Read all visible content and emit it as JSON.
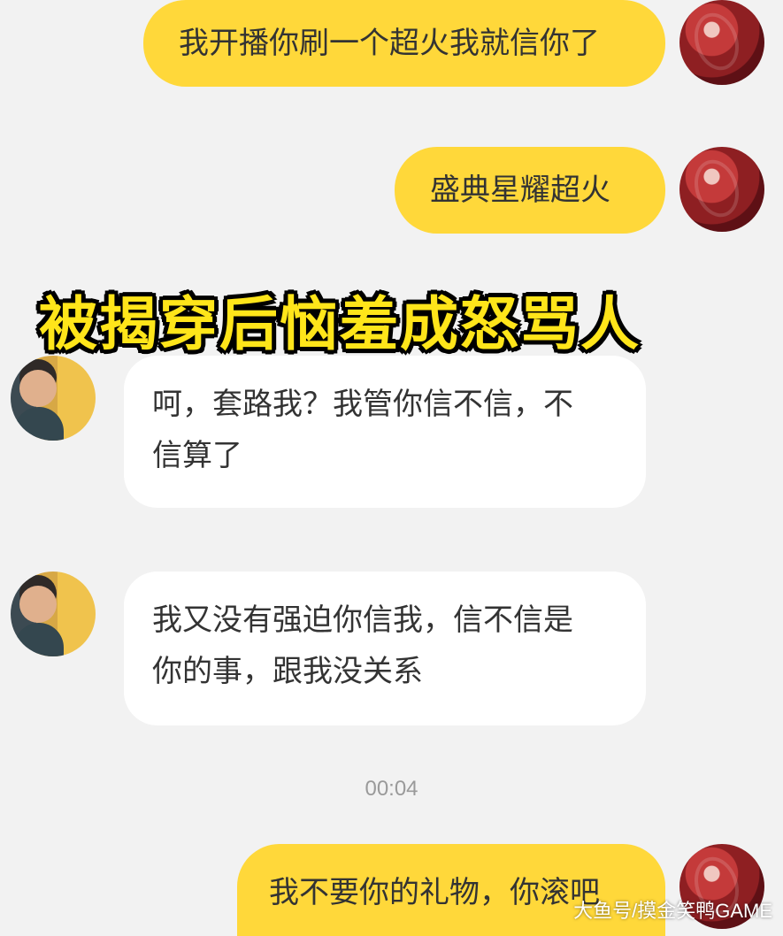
{
  "messages": [
    {
      "sender": "me",
      "text": "我开播你刷一个超火我就信你了"
    },
    {
      "sender": "me",
      "text": "盛典星耀超火"
    },
    {
      "sender": "other",
      "text": "呵，套路我？我管你信不信，不\n信算了"
    },
    {
      "sender": "other",
      "text": "我又没有强迫你信我，信不信是\n你的事，跟我没关系"
    },
    {
      "sender": "me",
      "text": "我不要你的礼物，你滚吧"
    }
  ],
  "timestamp": "00:04",
  "overlay_caption": "被揭穿后恼羞成怒骂人",
  "watermark": "大鱼号/摸金笑鸭GAME",
  "colors": {
    "background": "#f2f2f2",
    "outgoing_bubble": "#ffd83a",
    "incoming_bubble": "#ffffff",
    "caption_text": "#ffe51a",
    "caption_outline": "#000000"
  },
  "icons": {
    "me_avatar": "user-avatar-red",
    "other_avatar": "contact-avatar-photo"
  }
}
